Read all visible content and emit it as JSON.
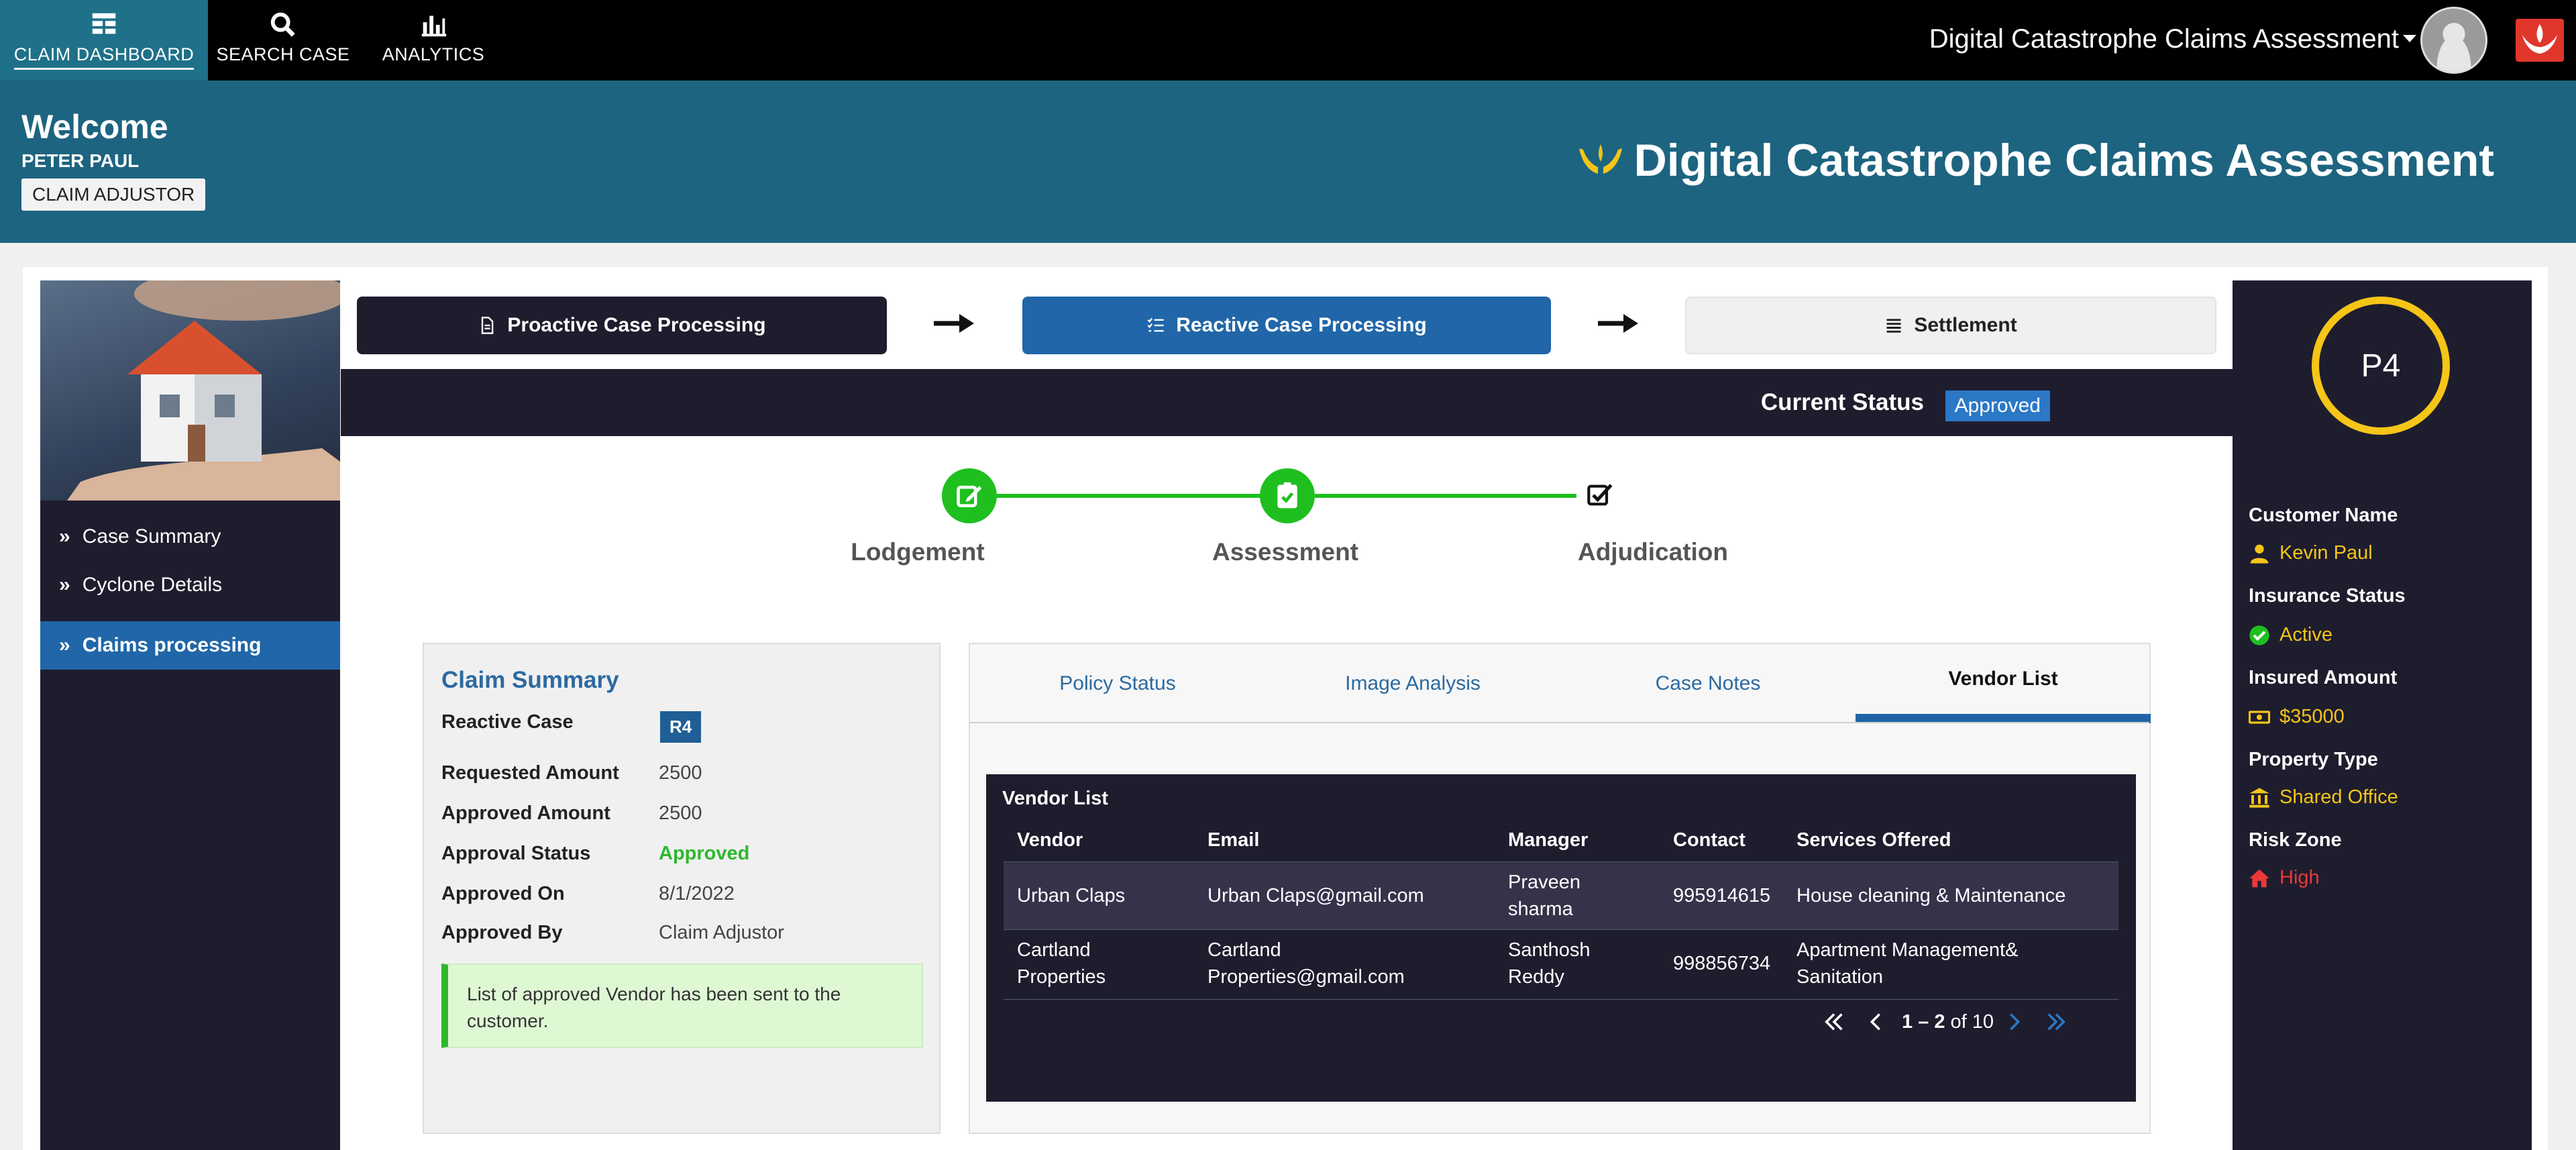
{
  "topnav": {
    "items": [
      {
        "label": "CLAIM DASHBOARD",
        "icon": "grid-icon",
        "active": true
      },
      {
        "label": "SEARCH CASE",
        "icon": "search-icon"
      },
      {
        "label": "ANALYTICS",
        "icon": "bar-chart-icon"
      }
    ],
    "app_title": "Digital Catastrophe Claims Assessment"
  },
  "banner": {
    "welcome": "Welcome",
    "username": "PETER PAUL",
    "role": "CLAIM ADJUSTOR",
    "title": "Digital Catastrophe Claims Assessment"
  },
  "sidebar": {
    "items": [
      {
        "label": "Case Summary"
      },
      {
        "label": "Cyclone Details"
      },
      {
        "label": "Claims processing",
        "active": true
      }
    ]
  },
  "process": {
    "steps": [
      {
        "label": "Proactive Case Processing",
        "icon": "document-icon"
      },
      {
        "label": "Reactive Case Processing",
        "icon": "list-check-icon",
        "active": true
      },
      {
        "label": "Settlement",
        "icon": "list-icon"
      }
    ]
  },
  "status": {
    "label": "Current Status",
    "value": "Approved"
  },
  "progress": {
    "stages": [
      {
        "label": "Lodgement",
        "icon": "edit-icon"
      },
      {
        "label": "Assessment",
        "icon": "clipboard-check-icon"
      },
      {
        "label": "Adjudication",
        "icon": "checkbox-icon"
      }
    ]
  },
  "claim_summary": {
    "title": "Claim Summary",
    "case_label": "Reactive Case",
    "case_badge": "R4",
    "rows": [
      {
        "label": "Requested Amount",
        "value": "2500"
      },
      {
        "label": "Approved Amount",
        "value": "2500"
      },
      {
        "label": "Approval Status",
        "value": "Approved"
      },
      {
        "label": "Approved On",
        "value": "8/1/2022"
      },
      {
        "label": "Approved By",
        "value": "Claim Adjustor"
      }
    ],
    "note": "List of approved Vendor has been sent to the customer."
  },
  "tabs": [
    {
      "label": "Policy Status"
    },
    {
      "label": "Image Analysis"
    },
    {
      "label": "Case Notes"
    },
    {
      "label": "Vendor List",
      "active": true
    }
  ],
  "vendor_list": {
    "title": "Vendor List",
    "columns": [
      "Vendor",
      "Email",
      "Manager",
      "Contact",
      "Services Offered"
    ],
    "rows": [
      {
        "vendor": "Urban Claps",
        "email": "Urban Claps@gmail.com",
        "manager": "Praveen sharma",
        "contact": "995914615",
        "services": "House cleaning & Maintenance"
      },
      {
        "vendor": "Cartland Properties",
        "email": "Cartland Properties@gmail.com",
        "manager": "Santhosh Reddy",
        "contact": "998856734",
        "services": "Apartment Management& Sanitation"
      }
    ],
    "pager": {
      "range": "1 – 2",
      "of": "of 10"
    }
  },
  "customer": {
    "priority": "P4",
    "fields": [
      {
        "label": "Customer Name",
        "value": "Kevin Paul",
        "icon": "user-icon"
      },
      {
        "label": "Insurance Status",
        "value": "Active",
        "icon": "check-circle-icon"
      },
      {
        "label": "Insured Amount",
        "value": "$35000",
        "icon": "money-icon"
      },
      {
        "label": "Property Type",
        "value": "Shared Office",
        "icon": "building-icon"
      },
      {
        "label": "Risk Zone",
        "value": "High",
        "icon": "home-icon",
        "color": "#e83a3a"
      }
    ]
  },
  "colors": {
    "brand": "#1d6480",
    "accent": "#2066a8",
    "success": "#1fbf1f",
    "highlight": "#f5c518",
    "dark": "#1e1d2e"
  }
}
